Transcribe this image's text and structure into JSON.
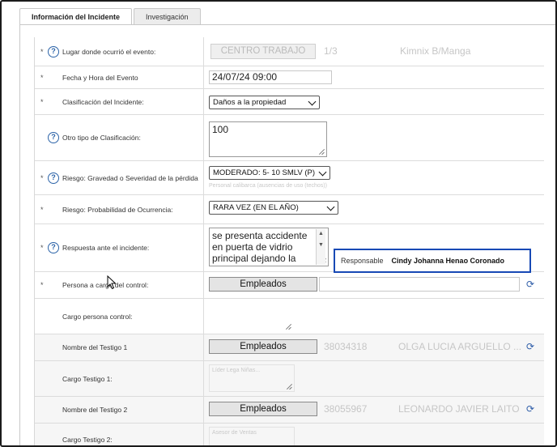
{
  "tabs": [
    {
      "label": "Información del Incidente",
      "active": true
    },
    {
      "label": "Investigación",
      "active": false
    }
  ],
  "rows": {
    "lugar": {
      "label": "Lugar donde ocurrió el evento:",
      "required": true,
      "help": true,
      "btn": "CENTRO TRABAJO",
      "code": "1/3",
      "place": "Kimnix B/Manga"
    },
    "fecha": {
      "label": "Fecha y Hora del Evento",
      "required": true,
      "value": "24/07/24 09:00"
    },
    "clasif": {
      "label": "Clasificación del Incidente:",
      "required": true,
      "selected": "Daños a la propiedad"
    },
    "otro": {
      "label": "Otro tipo de Clasificación:",
      "help": true,
      "value": "100"
    },
    "gravedad": {
      "label": "Riesgo: Gravedad o Severidad de la pérdida",
      "required": true,
      "help": true,
      "selected": "MODERADO: 5- 10 SMLV (P)",
      "hint": "Personal calibarca (ausencias de uso (techos))"
    },
    "probabilidad": {
      "label": "Riesgo: Probabilidad de Ocurrencia:",
      "required": true,
      "selected": "RARA VEZ (EN EL AÑO)"
    },
    "respuesta": {
      "label": "Respuesta ante el incidente:",
      "required": true,
      "help": true,
      "lines": [
        "se presenta accidente",
        "en puerta de vidrio",
        "principal dejando la"
      ],
      "resp_label": "Responsable",
      "resp_name": "Cindy Johanna Henao Coronado"
    },
    "persona": {
      "label": "Persona a cargo del control:",
      "required": true,
      "btn": "Empleados"
    },
    "cargo_persona": {
      "label": "Cargo persona control:"
    },
    "testigo1": {
      "label": "Nombre del Testigo 1",
      "btn": "Empleados",
      "id": "38034318",
      "name": "OLGA LUCIA ARGUELLO ..."
    },
    "cargo1": {
      "label": "Cargo Testigo 1:",
      "value": "Líder Lega Niñas..."
    },
    "testigo2": {
      "label": "Nombre del Testigo 2",
      "btn": "Empleados",
      "id": "38055967",
      "name": "LEONARDO JAVIER LAITO"
    },
    "cargo2": {
      "label": "Cargo Testigo 2:",
      "value": "Asesor de Ventas"
    }
  },
  "colors": {
    "accent": "#2b63a8",
    "highlight_border": "#1849b5"
  }
}
